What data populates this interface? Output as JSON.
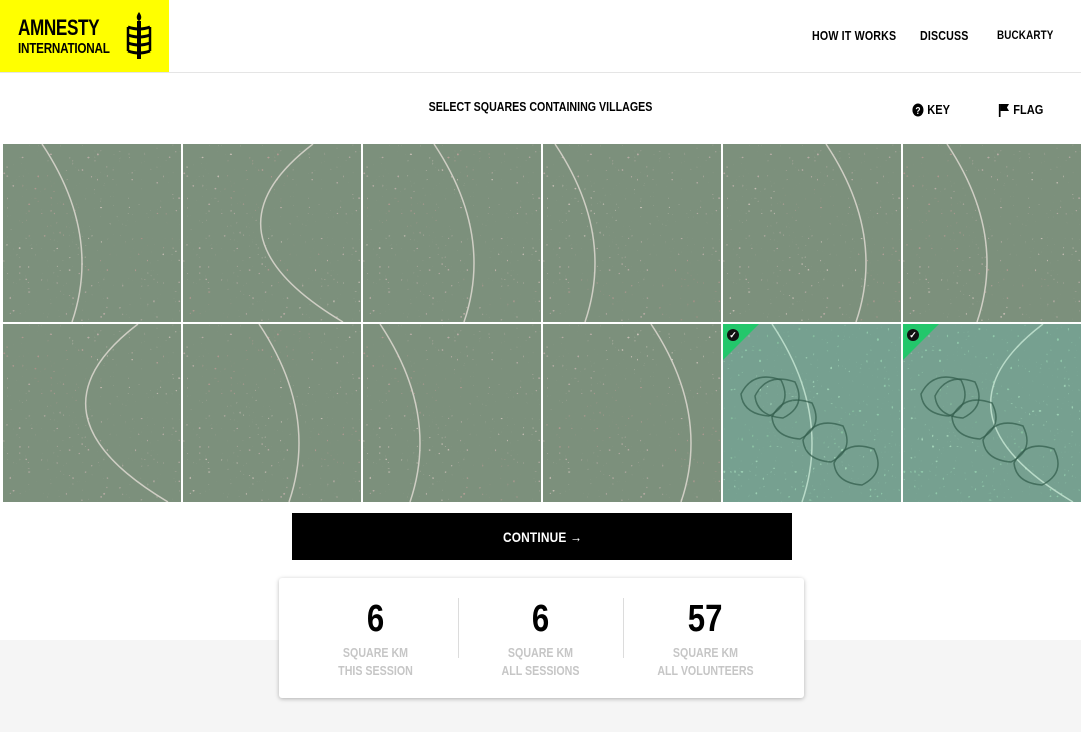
{
  "header": {
    "logo": {
      "line1": "AMNESTY",
      "line2": "INTERNATIONAL"
    },
    "nav": [
      {
        "label": "HOW IT WORKS"
      },
      {
        "label": "DISCUSS"
      },
      {
        "label": "BUCKARTY"
      }
    ]
  },
  "toolbar": {
    "instruction": "SELECT SQUARES CONTAINING VILLAGES",
    "key_label": "KEY",
    "flag_label": "FLAG"
  },
  "grid": {
    "rows": 2,
    "cols": 6,
    "tiles": [
      {
        "selected": false
      },
      {
        "selected": false
      },
      {
        "selected": false
      },
      {
        "selected": false
      },
      {
        "selected": false
      },
      {
        "selected": false
      },
      {
        "selected": false
      },
      {
        "selected": false
      },
      {
        "selected": false
      },
      {
        "selected": false
      },
      {
        "selected": true
      },
      {
        "selected": true
      }
    ],
    "selected_color": "#23c76b"
  },
  "continue_label": "CONTINUE →",
  "stats": [
    {
      "value": "6",
      "line1": "SQUARE KM",
      "line2": "THIS SESSION"
    },
    {
      "value": "6",
      "line1": "SQUARE KM",
      "line2": "ALL SESSIONS"
    },
    {
      "value": "57",
      "line1": "SQUARE KM",
      "line2": "ALL VOLUNTEERS"
    }
  ],
  "colors": {
    "brand_yellow": "#ffff00",
    "accent_green": "#23c76b"
  }
}
